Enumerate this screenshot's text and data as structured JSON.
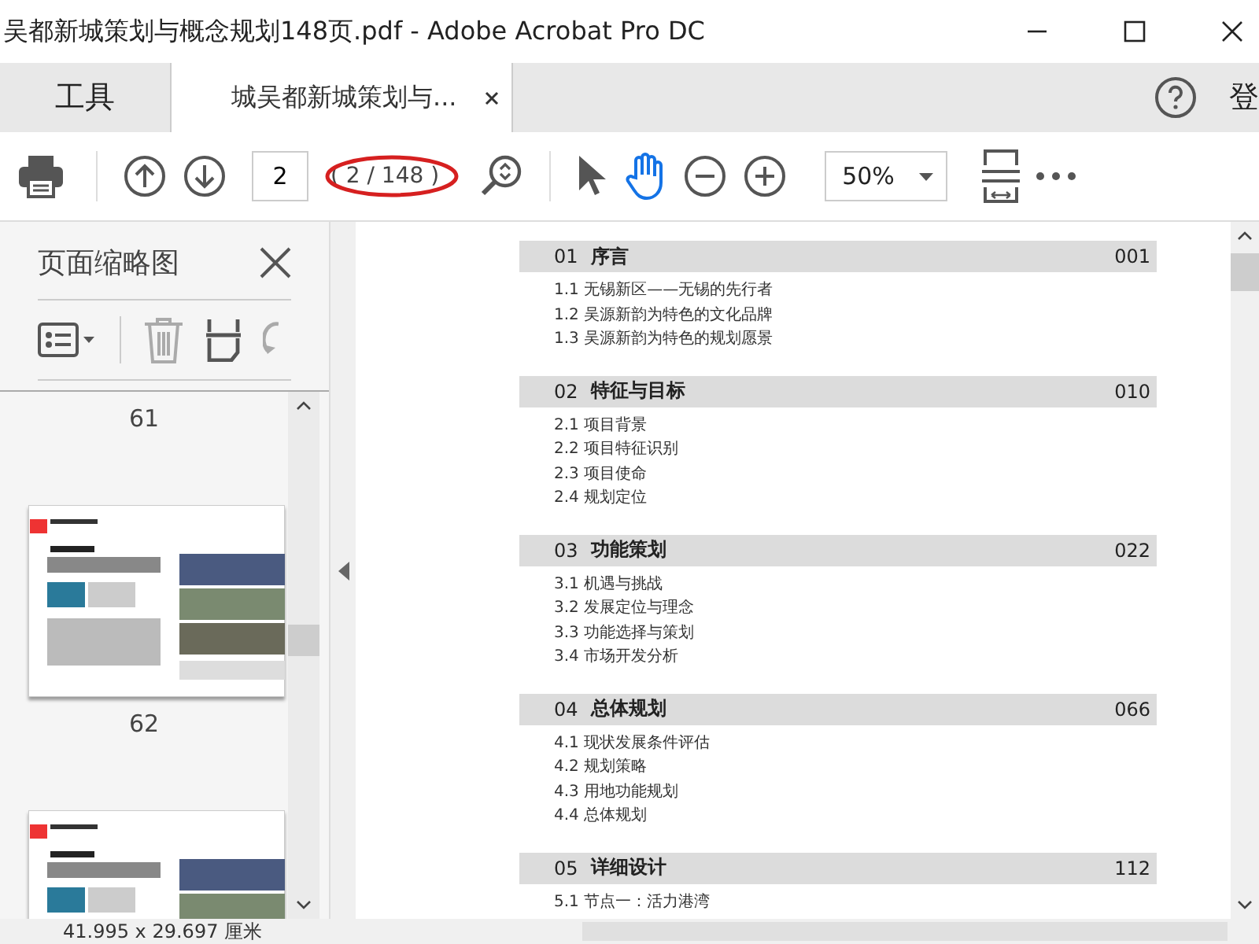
{
  "window": {
    "title": "吴都新城策划与概念规划148页.pdf - Adobe Acrobat Pro DC"
  },
  "tabs": [
    {
      "kind": "tools",
      "label": "工具",
      "selected": false
    },
    {
      "kind": "document",
      "label": "城吴都新城策划与...",
      "selected": true
    }
  ],
  "account": {
    "label": "登"
  },
  "toolbar": {
    "page_number": "2",
    "page_count": "( 2 / 148 )",
    "zoom": "50%",
    "tools": [
      {
        "kind": "select",
        "selected": false
      },
      {
        "kind": "hand",
        "selected": true
      }
    ]
  },
  "thumbnails_panel": {
    "title": "页面缩略图",
    "items": [
      {
        "kind": "label",
        "text": "61"
      },
      {
        "kind": "thumbnail"
      },
      {
        "kind": "label",
        "text": "62"
      },
      {
        "kind": "thumbnail"
      }
    ]
  },
  "document": {
    "sections": [
      {
        "number": "01",
        "title": "序言",
        "page": "001",
        "items": [
          {
            "number": "1.1",
            "title": "无锡新区——无锡的先行者"
          },
          {
            "number": "1.2",
            "title": "吴源新韵为特色的文化品牌"
          },
          {
            "number": "1.3",
            "title": "吴源新韵为特色的规划愿景"
          }
        ]
      },
      {
        "number": "02",
        "title": "特征与目标",
        "page": "010",
        "items": [
          {
            "number": "2.1",
            "title": "项目背景"
          },
          {
            "number": "2.2",
            "title": "项目特征识别"
          },
          {
            "number": "2.3",
            "title": "项目使命"
          },
          {
            "number": "2.4",
            "title": "规划定位"
          }
        ]
      },
      {
        "number": "03",
        "title": "功能策划",
        "page": "022",
        "items": [
          {
            "number": "3.1",
            "title": "机遇与挑战"
          },
          {
            "number": "3.2",
            "title": "发展定位与理念"
          },
          {
            "number": "3.3",
            "title": "功能选择与策划"
          },
          {
            "number": "3.4",
            "title": "市场开发分析"
          }
        ]
      },
      {
        "number": "04",
        "title": "总体规划",
        "page": "066",
        "items": [
          {
            "number": "4.1",
            "title": "现状发展条件评估"
          },
          {
            "number": "4.2",
            "title": "规划策略"
          },
          {
            "number": "4.3",
            "title": "用地功能规划"
          },
          {
            "number": "4.4",
            "title": "总体规划"
          }
        ]
      },
      {
        "number": "05",
        "title": "详细设计",
        "page": "112",
        "items": [
          {
            "number": "5.1",
            "title": "节点一：活力港湾"
          }
        ]
      }
    ]
  },
  "status_bar": {
    "size": "41.995 x 29.697 厘米"
  }
}
